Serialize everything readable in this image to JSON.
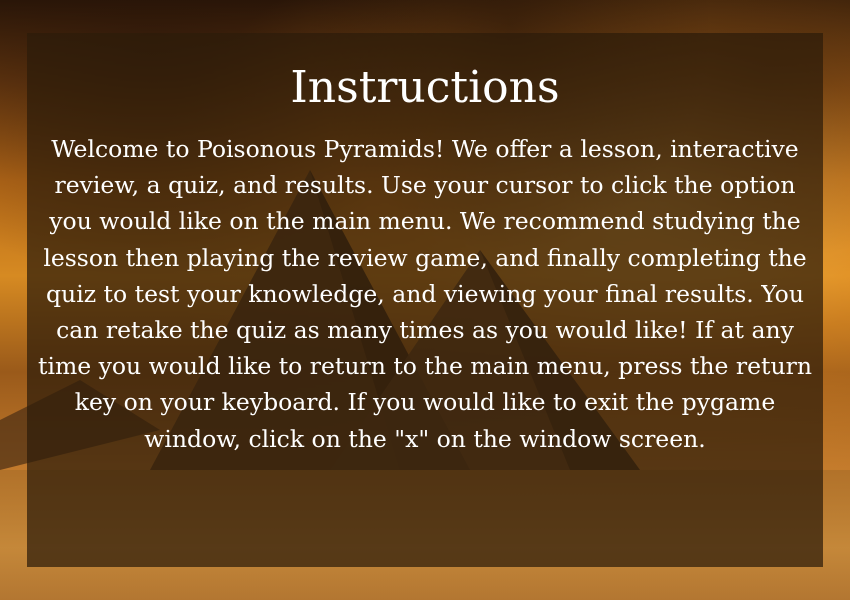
{
  "screen": {
    "title": "Instructions",
    "body": "Welcome to Poisonous Pyramids! We offer a lesson, interactive review, a quiz, and results. Use your cursor to click the option you would like on the main menu. We recommend studying the lesson then playing the review game, and finally completing the quiz to test your knowledge, and viewing your final results. You can retake the quiz as many times as you would like! If at any time you would like to return to the main menu, press the return key on your keyboard. If you would like to exit the pygame window, click on the \"x\" on the window screen."
  },
  "colors": {
    "panel": "#2d1c0a",
    "text": "#ffffff",
    "sky_accent": "#d68a22"
  }
}
